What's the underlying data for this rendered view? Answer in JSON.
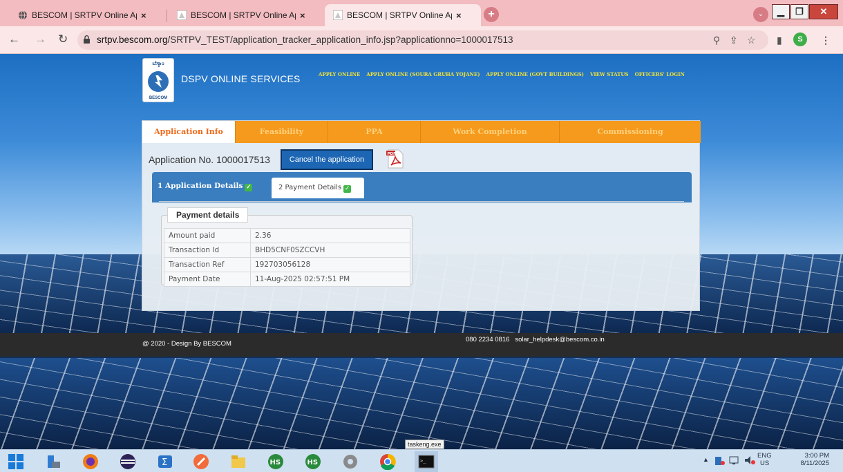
{
  "browser": {
    "tabs": [
      {
        "title": "BESCOM | SRTPV Online Applicat",
        "active": false
      },
      {
        "title": "BESCOM | SRTPV Online Applicat",
        "active": false
      },
      {
        "title": "BESCOM | SRTPV Online Applicat",
        "active": true
      }
    ],
    "close_glyph": "×",
    "new_tab_glyph": "+",
    "tab_search_glyph": "⌄",
    "url_domain": "srtpv.bescom.org",
    "url_path": "/SRTPV_TEST/application_tracker_application_info.jsp?applicationno=1000017513",
    "profile_initial": "S"
  },
  "site": {
    "logo_kannada": "ಬೆಸ್ಕಾಂ",
    "logo_text": "BESCOM",
    "title": "DSPV ONLINE SERVICES",
    "nav": [
      "APPLY ONLINE",
      "APPLY ONLINE (SOURA GRUHA YOJANE)",
      "APPLY ONLINE (GOVT BUILDINGS)",
      "VIEW STATUS",
      "OFFICERS' LOGIN"
    ]
  },
  "steps": [
    {
      "label": "Application Info",
      "active": true
    },
    {
      "label": "Feasibility",
      "active": false
    },
    {
      "label": "PPA",
      "active": false
    },
    {
      "label": "Work Completion",
      "active": false
    },
    {
      "label": "Commissioning",
      "active": false
    }
  ],
  "application": {
    "number_text": "Application No. 1000017513",
    "cancel_label": "Cancel the application"
  },
  "detail_tabs": {
    "tab1": "1 Application Details",
    "tab2": "2 Payment Details",
    "check_glyph": "✓"
  },
  "payment": {
    "legend": "Payment details",
    "rows": [
      {
        "label": "Amount paid",
        "value": "2.36"
      },
      {
        "label": "Transaction Id",
        "value": "BHD5CNF0SZCCVH"
      },
      {
        "label": "Transaction Ref",
        "value": "192703056128"
      },
      {
        "label": "Payment Date",
        "value": "11-Aug-2025 02:57:51 PM"
      }
    ]
  },
  "footer": {
    "copyright": "@ 2020 - Design By BESCOM",
    "contact": "080 2234 0816   solar_helpdesk@bescom.co.in"
  },
  "tooltip": "taskeng.exe",
  "taskbar": {
    "lang": "ENG",
    "region": "US",
    "time": "3:00 PM",
    "date": "8/11/2025",
    "hs_label": "HS"
  },
  "colors": {
    "step_orange": "#f59a1c",
    "active_step_text": "#ef6a1a",
    "button_blue": "#1c66b4",
    "tab_strip": "#f3bcc0"
  }
}
